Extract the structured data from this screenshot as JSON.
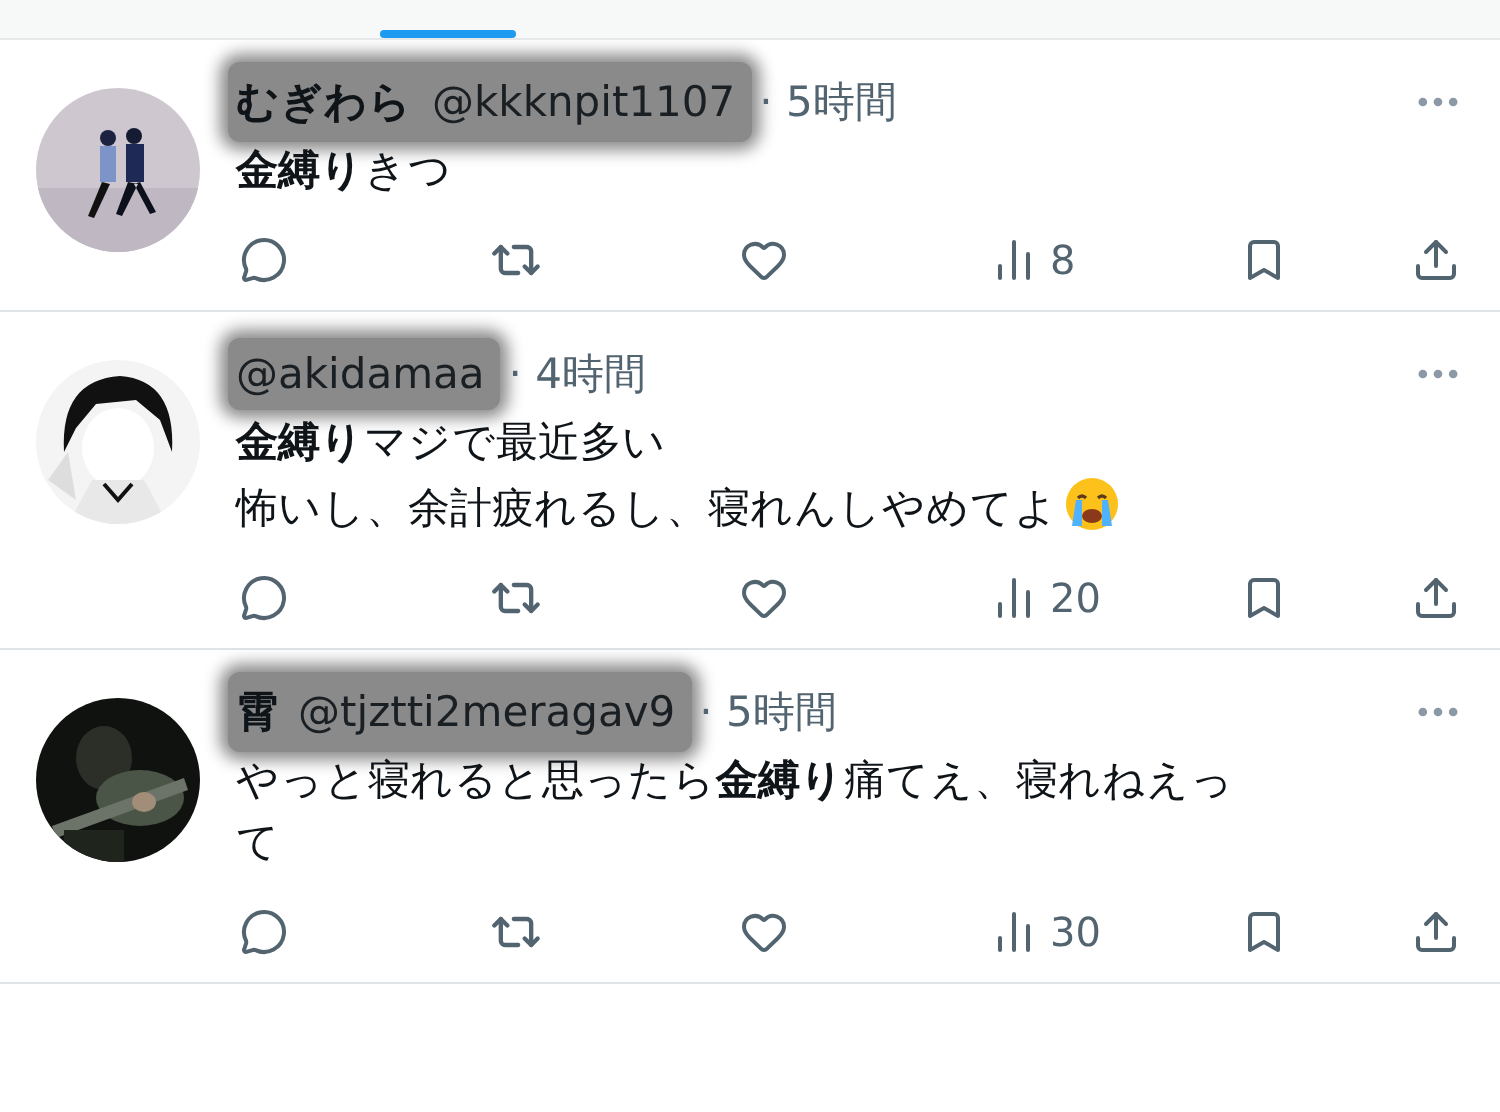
{
  "posts": [
    {
      "name": "むぎわら",
      "handle": "@kkknpit1107",
      "time": "· 5時間",
      "redacted": true,
      "lines": [
        "**金縛り**きつ"
      ],
      "emoji": false,
      "views": "8"
    },
    {
      "handle": "@akidamaa",
      "time": "· 4時間",
      "redacted": true,
      "lines": [
        "**金縛り**マジで最近多い",
        "怖いし、余計疲れるし、寝れんしやめてよ"
      ],
      "emoji": true,
      "views": "20"
    },
    {
      "name": "霄",
      "handle": "@tjztti2meragav9",
      "time": "· 5時間",
      "redacted": true,
      "lines": [
        "やっと寝れると思ったら**金縛り**痛てえ、寝れねえって"
      ],
      "emoji": false,
      "views": "30"
    }
  ]
}
